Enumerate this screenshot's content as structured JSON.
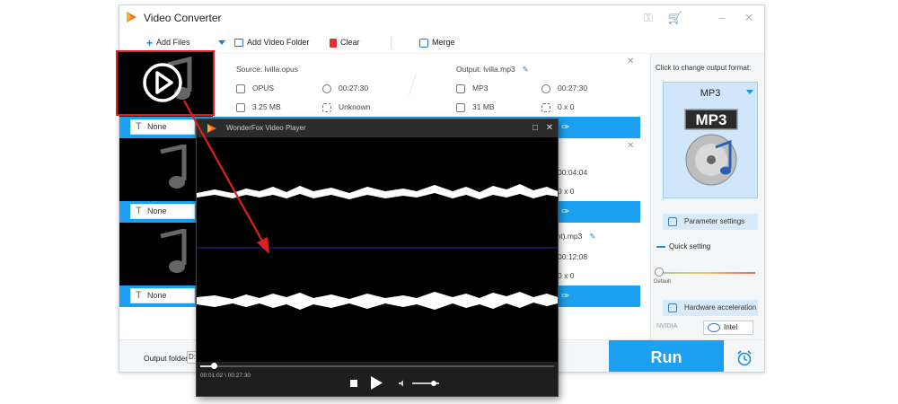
{
  "app": {
    "title": "Video Converter",
    "colors": {
      "accent": "#1ba0f2",
      "highlight": "#e02020"
    }
  },
  "toolbar": {
    "add_files": "Add Files",
    "add_folder": "Add Video Folder",
    "clear": "Clear",
    "merge": "Merge"
  },
  "files": [
    {
      "source": "Source: lvilla.opus",
      "src_format": "OPUS",
      "src_duration": "00:27:30",
      "src_size": "3.25 MB",
      "src_resolution": "Unknown",
      "output": "Output: lvilla.mp3",
      "out_format": "MP3",
      "out_duration": "00:27:30",
      "out_size": "31 MB",
      "out_resolution": "0 x 0",
      "subtitle": "None"
    },
    {
      "out_duration": "00:04:04",
      "out_resolution": "0 x 0",
      "subtitle": "None"
    },
    {
      "output_partial": "ement).mp3",
      "out_duration": "00:12:08",
      "out_resolution": "0 x 0",
      "subtitle": "None"
    }
  ],
  "right_panel": {
    "change_format": "Click to change output format:",
    "format": "MP3",
    "format_icon_label": "MP3",
    "parameter_settings": "Parameter settings",
    "quick_setting": "Quick setting",
    "default_label": "Default",
    "hardware_acceleration": "Hardware acceleration",
    "nvidia": "NVIDIA",
    "intel": "Intel"
  },
  "bottom": {
    "output_folder": "Output folder:",
    "folder_value": "D:",
    "run": "Run"
  },
  "player": {
    "title": "WonderFox Video Player",
    "current_time": "00:01:02",
    "time_sep": "\\",
    "total_time": "00:27:30",
    "progress": 0.038,
    "volume": 0.8
  }
}
